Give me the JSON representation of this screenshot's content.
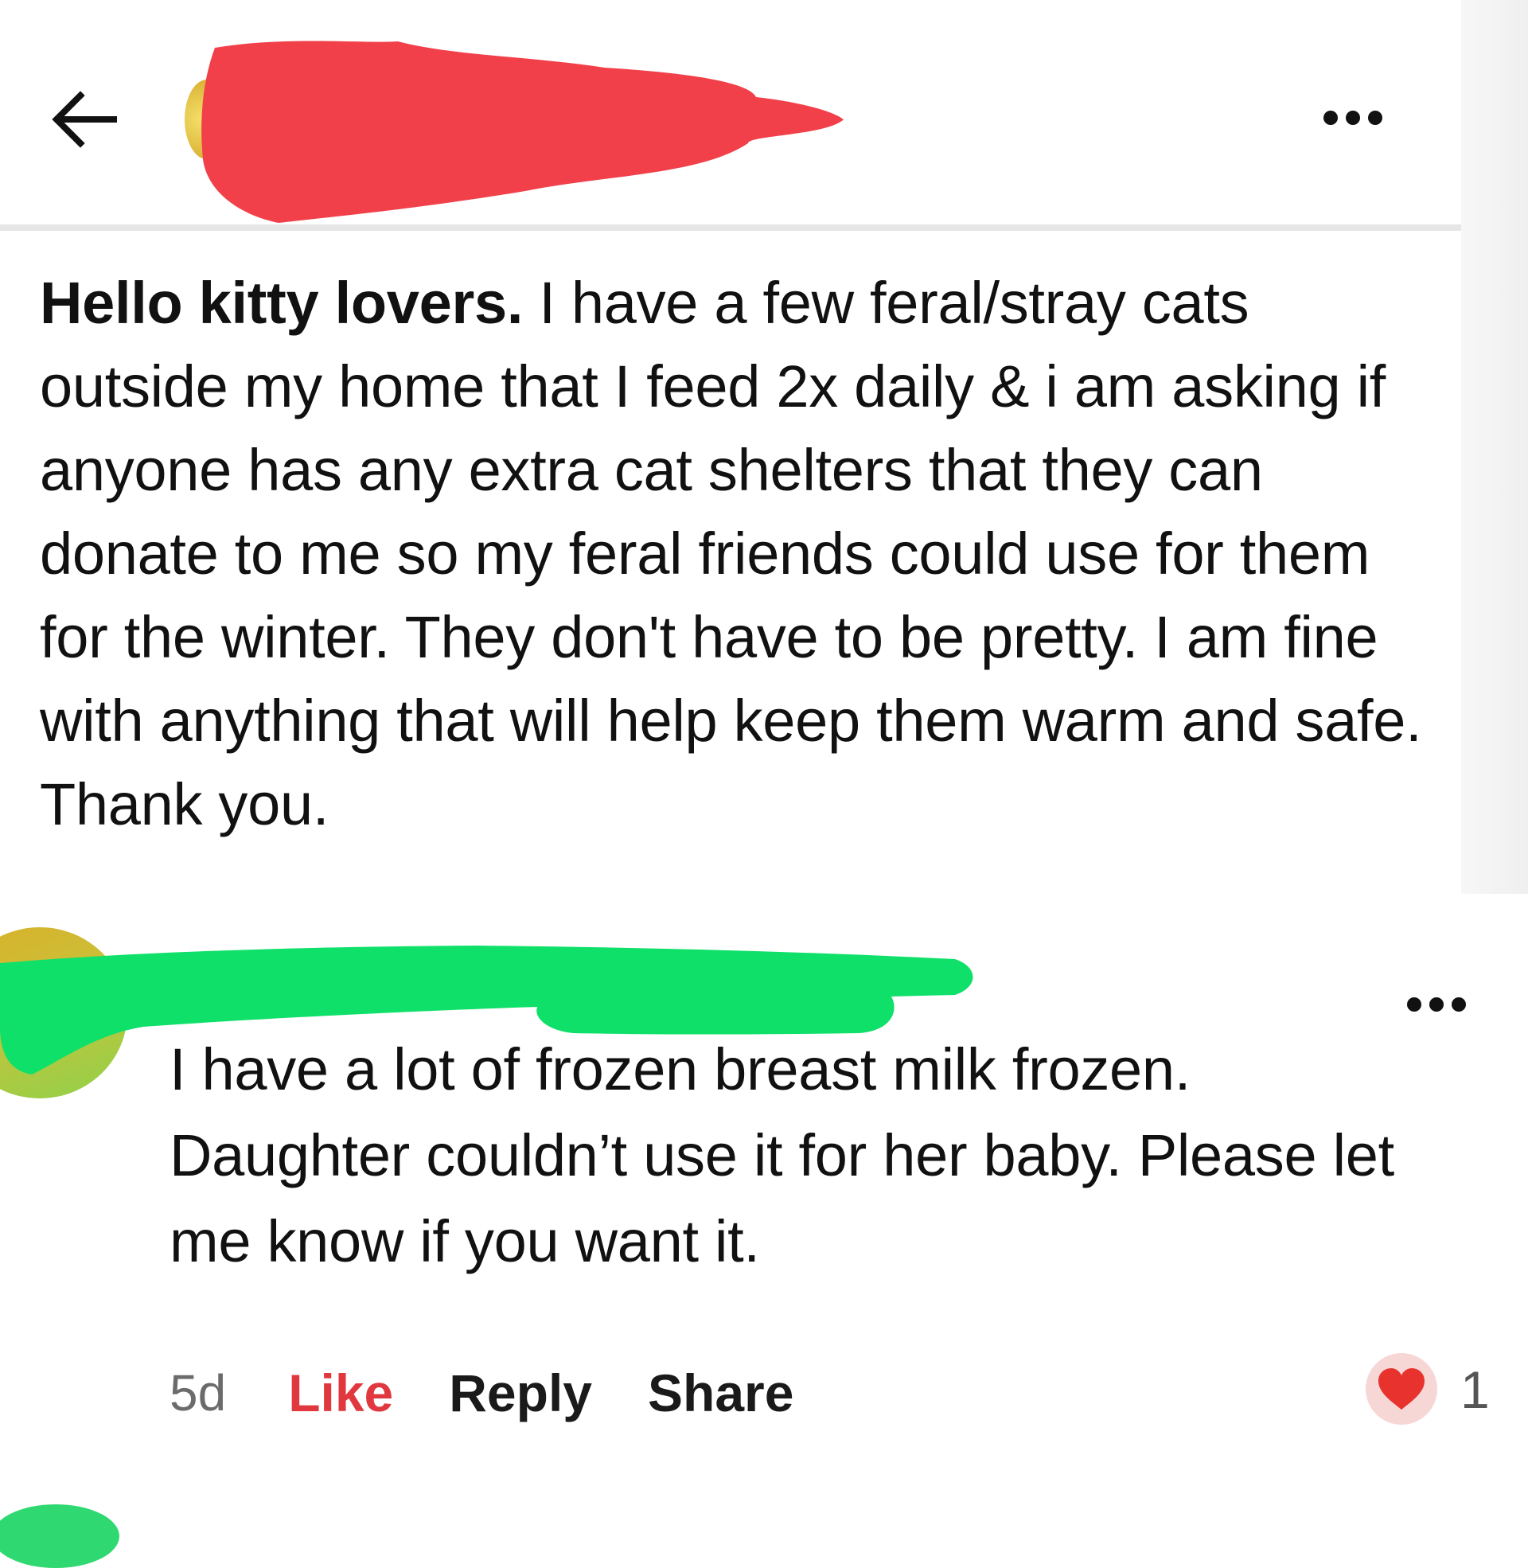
{
  "header": {
    "back_icon": "arrow-left-icon",
    "more_icon": "more-horizontal-icon"
  },
  "post": {
    "bold_lead": "Hello kitty lovers.",
    "body": " I have a few feral/stray cats outside my home that I feed 2x daily & i am asking if anyone has any extra cat shelters that  they can donate to me so my feral friends could use for them for the winter. They don't have to be pretty. I am fine with anything that will help keep them warm and safe. Thank you."
  },
  "comment": {
    "text": "I have a lot of frozen breast milk frozen. Daughter couldn’t use it for her baby.   Please let me know if you want it.",
    "time": "5d",
    "like_label": "Like",
    "reply_label": "Reply",
    "share_label": "Share",
    "reaction_icon": "heart-icon",
    "reaction_count": "1",
    "more_icon": "more-horizontal-icon"
  },
  "colors": {
    "like_red": "#e0383e",
    "redact_red": "#f2404a",
    "redact_green": "#0fe06a"
  }
}
